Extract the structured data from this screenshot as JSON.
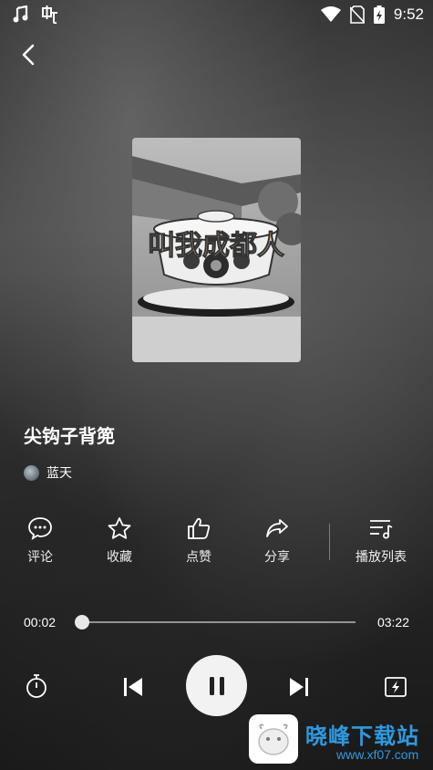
{
  "status_bar": {
    "time": "9:52"
  },
  "song": {
    "title": "尖钩子背篼",
    "artist": "蓝天"
  },
  "cover": {
    "overlay_text": "叫我成都人"
  },
  "actions": [
    {
      "label": "评论",
      "icon": "comment-icon"
    },
    {
      "label": "收藏",
      "icon": "star-icon"
    },
    {
      "label": "点赞",
      "icon": "thumb-up-icon"
    },
    {
      "label": "分享",
      "icon": "share-icon"
    },
    {
      "label": "播放列表",
      "icon": "playlist-icon"
    }
  ],
  "progress": {
    "current": "00:02",
    "total": "03:22",
    "fraction": 0.01
  },
  "watermark": {
    "text": "晓峰下载站",
    "url": "www.xf07.com"
  }
}
